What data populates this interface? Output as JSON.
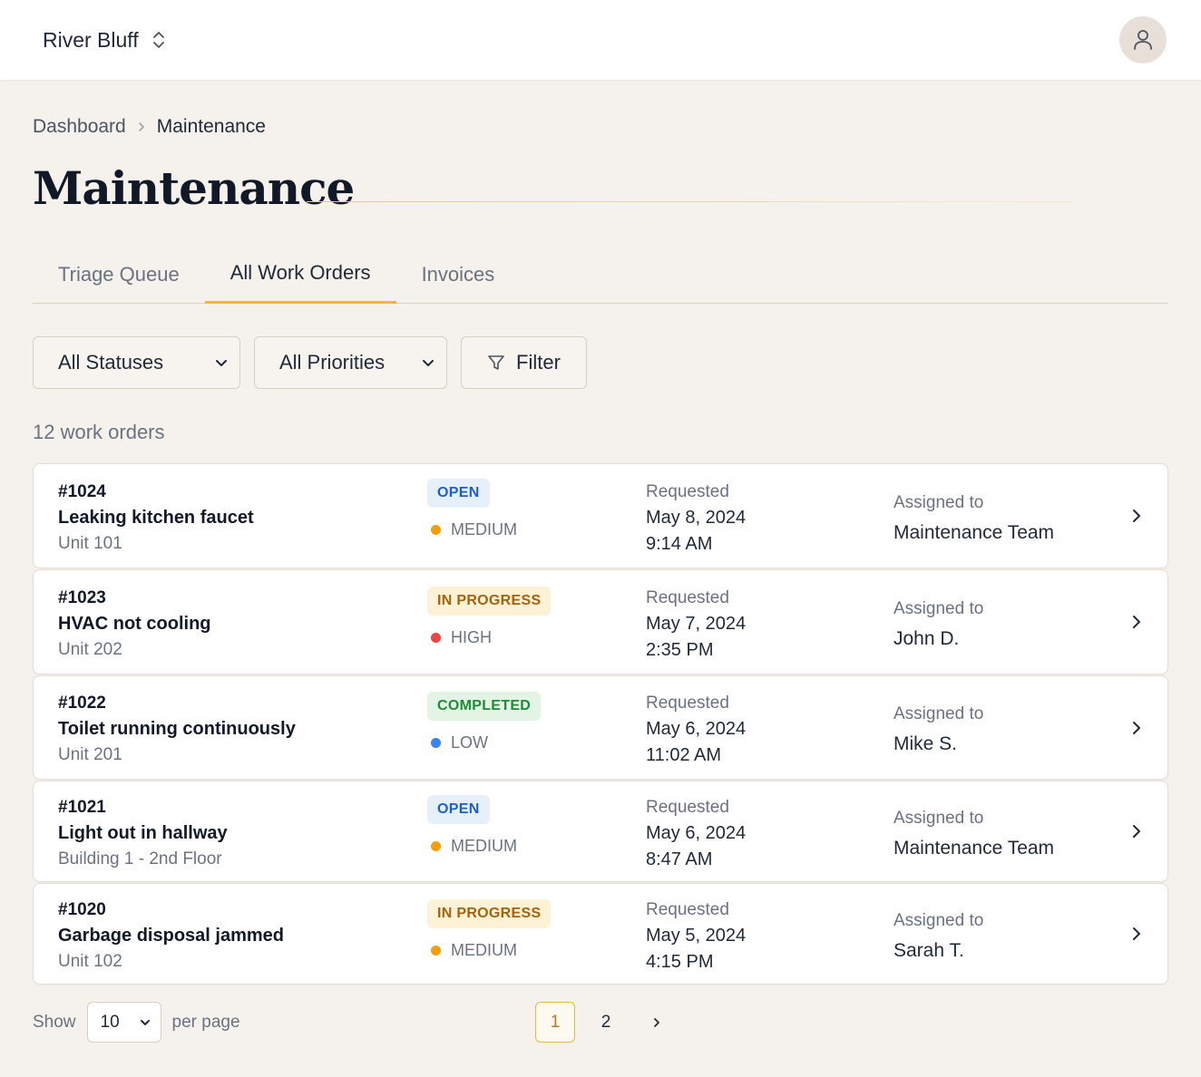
{
  "header": {
    "property_name": "River Bluff",
    "switch_icon": "chevron-up-down-icon",
    "avatar_icon": "user-icon"
  },
  "breadcrumb": {
    "parent": "Dashboard",
    "current": "Maintenance"
  },
  "page": {
    "title": "Maintenance"
  },
  "tabs": [
    {
      "label": "Triage Queue",
      "active": false
    },
    {
      "label": "All Work Orders",
      "active": true
    },
    {
      "label": "Invoices",
      "active": false
    }
  ],
  "filters": {
    "status_value": "All Statuses",
    "priority_value": "All Priorities",
    "filter_label": "Filter"
  },
  "count_label": "12 work orders",
  "work_orders": [
    {
      "id": "#1024",
      "title": "Leaking kitchen faucet",
      "location": "Unit 101",
      "status": "OPEN",
      "status_kind": "open",
      "priority": "MEDIUM",
      "priority_color": "#f59e0b",
      "requested_label": "Requested",
      "date": "May 8, 2024",
      "time": "9:14 AM",
      "assigned_label": "Assigned to",
      "assignee": "Maintenance Team"
    },
    {
      "id": "#1023",
      "title": "HVAC not cooling",
      "location": "Unit 202",
      "status": "IN PROGRESS",
      "status_kind": "progress",
      "priority": "HIGH",
      "priority_color": "#ef4444",
      "requested_label": "Requested",
      "date": "May 7, 2024",
      "time": "2:35 PM",
      "assigned_label": "Assigned to",
      "assignee": "John D."
    },
    {
      "id": "#1022",
      "title": "Toilet running continuously",
      "location": "Unit 201",
      "status": "COMPLETED",
      "status_kind": "completed",
      "priority": "LOW",
      "priority_color": "#3b82f6",
      "requested_label": "Requested",
      "date": "May 6, 2024",
      "time": "11:02 AM",
      "assigned_label": "Assigned to",
      "assignee": "Mike S."
    },
    {
      "id": "#1021",
      "title": "Light out in hallway",
      "location": "Building 1 - 2nd Floor",
      "status": "OPEN",
      "status_kind": "open",
      "priority": "MEDIUM",
      "priority_color": "#f59e0b",
      "requested_label": "Requested",
      "date": "May 6, 2024",
      "time": "8:47 AM",
      "assigned_label": "Assigned to",
      "assignee": "Maintenance Team"
    },
    {
      "id": "#1020",
      "title": "Garbage disposal jammed",
      "location": "Unit 102",
      "status": "IN PROGRESS",
      "status_kind": "progress",
      "priority": "MEDIUM",
      "priority_color": "#f59e0b",
      "requested_label": "Requested",
      "date": "May 5, 2024",
      "time": "4:15 PM",
      "assigned_label": "Assigned to",
      "assignee": "Sarah T."
    }
  ],
  "pagination": {
    "show_label": "Show",
    "page_size": "10",
    "per_page_label": "per page",
    "pages": [
      "1",
      "2"
    ],
    "current_page": "1"
  }
}
